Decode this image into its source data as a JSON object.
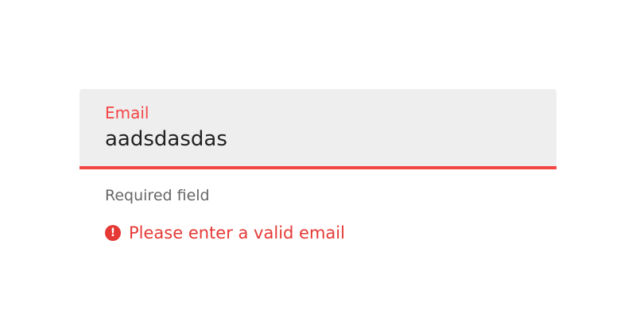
{
  "email_field": {
    "label": "Email",
    "value": "aadsdasdas",
    "helper_text": "Required field",
    "error": {
      "icon": "exclamation-circle-icon",
      "message": "Please enter a valid email"
    }
  },
  "colors": {
    "error": "#f44545",
    "field_background": "#eeeeee",
    "text": "#222222",
    "helper_text": "#666666"
  }
}
